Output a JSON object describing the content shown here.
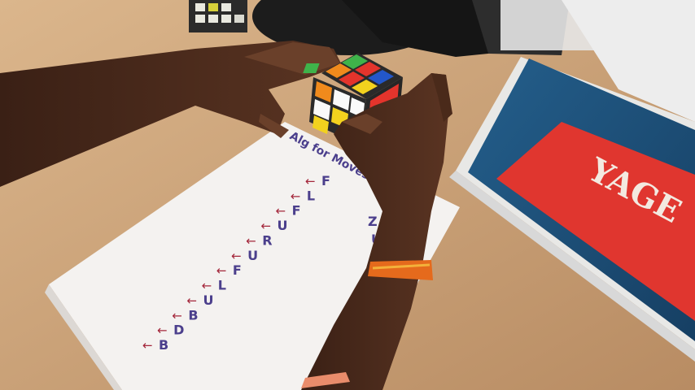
{
  "scene": {
    "title_on_paper": "Alg for Moves",
    "paper_moves": [
      "F",
      "L",
      "F",
      "U",
      "R",
      "U",
      "F",
      "L",
      "U",
      "B",
      "D",
      "B"
    ],
    "paper_moves_right": [
      "Z",
      "U"
    ],
    "book_cover_text": "YAGE",
    "colors": {
      "desk": "#c89d74",
      "paper": "#f4f2f0",
      "ink_letters": "#4b3f8c",
      "ink_arrows": "#a3263a",
      "book_red": "#e0362f",
      "book_blue": "#1e5a86",
      "skin": "#4a2a1a",
      "thread": "#e56a1c"
    },
    "cube_stickers": [
      "yellow",
      "orange",
      "red",
      "blue",
      "green",
      "white"
    ]
  }
}
